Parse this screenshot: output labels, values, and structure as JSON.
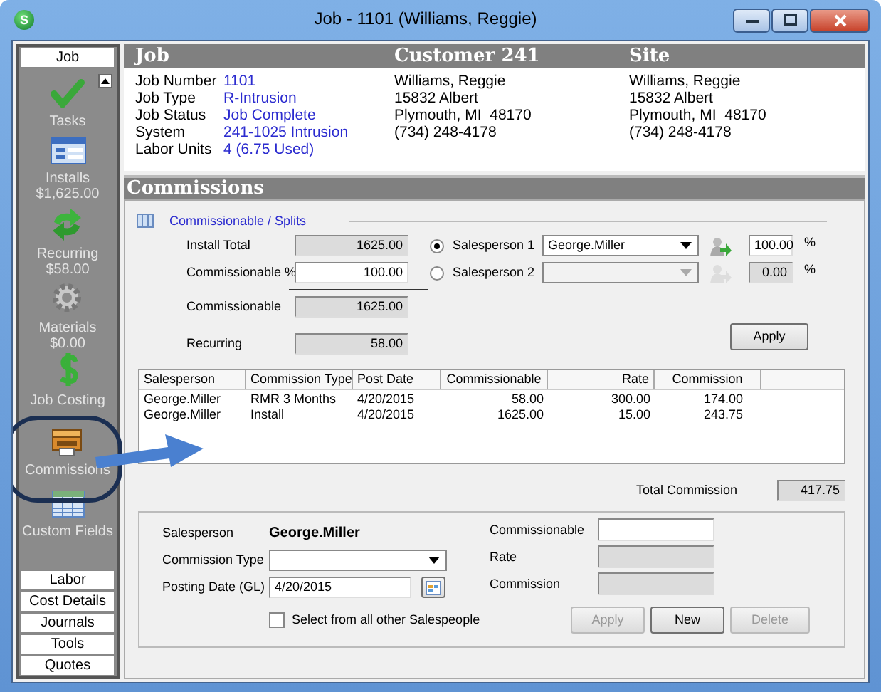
{
  "window": {
    "icon_letter": "S",
    "title": "Job - 1101 (Williams, Reggie)"
  },
  "sidebar": {
    "header": "Job",
    "items": [
      {
        "label": "Tasks"
      },
      {
        "label": "Installs",
        "amount": "$1,625.00"
      },
      {
        "label": "Recurring",
        "amount": "$58.00"
      },
      {
        "label": "Materials",
        "amount": "$0.00"
      },
      {
        "label": "Job Costing"
      },
      {
        "label": "Commissions"
      },
      {
        "label": "Custom Fields"
      }
    ],
    "tabs": [
      "Labor",
      "Cost Details",
      "Journals",
      "Tools",
      "Quotes"
    ]
  },
  "job_header": {
    "headings": [
      "Job",
      "Customer 241",
      "Site"
    ]
  },
  "job_info": [
    {
      "label": "Job Number",
      "value": "1101"
    },
    {
      "label": "Job Type",
      "value": "R-Intrusion"
    },
    {
      "label": "Job Status",
      "value": "Job Complete"
    },
    {
      "label": "System",
      "value": "241-1025 Intrusion"
    },
    {
      "label": "Labor Units",
      "value": "4 (6.75 Used)"
    }
  ],
  "customer": [
    "Williams, Reggie",
    "15832 Albert",
    "Plymouth, MI  48170",
    "(734) 248-4178"
  ],
  "site": [
    "Williams, Reggie",
    "15832 Albert",
    "Plymouth, MI  48170",
    "(734) 248-4178"
  ],
  "commissions": {
    "title": "Commissions",
    "splits_link": "Commissionable / Splits",
    "amounts": [
      {
        "label": "Install Total",
        "value": "1625.00",
        "disabled": true
      },
      {
        "label": "Commissionable %",
        "value": "100.00",
        "disabled": false
      },
      {
        "label": "Commissionable",
        "value": "1625.00",
        "disabled": true
      },
      {
        "label": "Recurring",
        "value": "58.00",
        "disabled": true
      }
    ],
    "salespeople": [
      {
        "label": "Salesperson 1",
        "value": "George.Miller",
        "percent": "100.00",
        "unit": "%",
        "selected": true,
        "disabled": false
      },
      {
        "label": "Salesperson 2",
        "percent": "0.00",
        "unit": "%",
        "selected": false,
        "disabled": true
      }
    ],
    "apply_button": "Apply"
  },
  "table": {
    "columns": [
      "Salesperson",
      "Commission Type",
      "Post Date",
      "Commissionable",
      "Rate",
      "Commission"
    ],
    "rows": [
      [
        "George.Miller",
        "RMR 3 Months",
        "4/20/2015",
        "58.00",
        "300.00",
        "174.00"
      ],
      [
        "George.Miller",
        "Install",
        "4/20/2015",
        "1625.00",
        "15.00",
        "243.75"
      ]
    ]
  },
  "total": {
    "label": "Total Commission",
    "value": "417.75"
  },
  "detail": {
    "salesperson_label": "Salesperson",
    "salesperson": "George.Miller",
    "fields": [
      {
        "label": "Commission Type",
        "kind": "dropdown"
      },
      {
        "label": "Posting Date (GL)",
        "kind": "date",
        "value": "4/20/2015"
      }
    ],
    "checkbox": {
      "label": "Select from all other Salespeople",
      "checked": false
    },
    "amounts": [
      {
        "label": "Commissionable",
        "disabled": false
      },
      {
        "label": "Rate",
        "disabled": true
      },
      {
        "label": "Commission",
        "disabled": true
      }
    ],
    "buttons": [
      {
        "label": "Apply",
        "disabled": true
      },
      {
        "label": "New",
        "disabled": false
      },
      {
        "label": "Delete",
        "disabled": true
      }
    ]
  }
}
